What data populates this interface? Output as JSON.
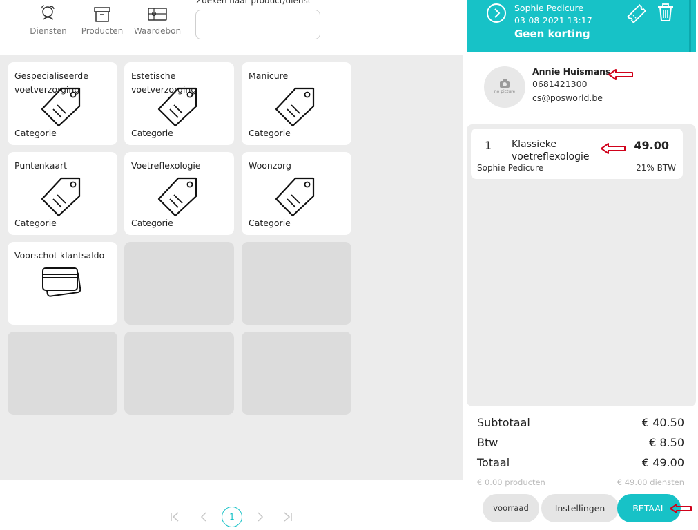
{
  "toolbar": {
    "services_label": "Diensten",
    "products_label": "Producten",
    "voucher_label": "Waardebon",
    "search_label": "Zoeken naar product/dienst",
    "search_value": ""
  },
  "tiles": [
    {
      "name": "Gespecialiseerde voetverzorging",
      "type": "Categorie",
      "icon": "tag-icon"
    },
    {
      "name": "Estetische voetverzorging",
      "type": "Categorie",
      "icon": "tag-icon"
    },
    {
      "name": "Manicure",
      "type": "Categorie",
      "icon": "tag-icon"
    },
    {
      "name": "Puntenkaart",
      "type": "Categorie",
      "icon": "tag-icon"
    },
    {
      "name": "Voetreflexologie",
      "type": "Categorie",
      "icon": "tag-icon"
    },
    {
      "name": "Woonzorg",
      "type": "Categorie",
      "icon": "tag-icon"
    },
    {
      "name": "Voorschot klantsaldo",
      "type": "",
      "icon": "credit-card-icon"
    }
  ],
  "pagination": {
    "current_page": "1"
  },
  "header": {
    "employee": "Sophie Pedicure",
    "datetime": "03-08-2021 13:17",
    "discount": "Geen korting",
    "bg_color": "#17c2c7"
  },
  "customer": {
    "avatar_text": "no picture",
    "name": "Annie Huismans",
    "phone": "0681421300",
    "email": "cs@posworld.be"
  },
  "cart": {
    "lines": [
      {
        "qty": "1",
        "product": "Klassieke voetreflexologie",
        "price": "49.00",
        "employee": "Sophie Pedicure",
        "vat": "21% BTW"
      }
    ]
  },
  "totals": {
    "subtotal_label": "Subtotaal",
    "subtotal": "€ 40.50",
    "vat_label": "Btw",
    "vat": "€ 8.50",
    "total_label": "Totaal",
    "total": "€ 49.00",
    "products_sum": "€ 0.00 producten",
    "services_sum": "€ 49.00 diensten"
  },
  "buttons": {
    "stock": "voorraad",
    "settings": "Instellingen",
    "pay": "BETAAL"
  },
  "colors": {
    "accent": "#17c2c7",
    "annotation": "#d0021b"
  }
}
